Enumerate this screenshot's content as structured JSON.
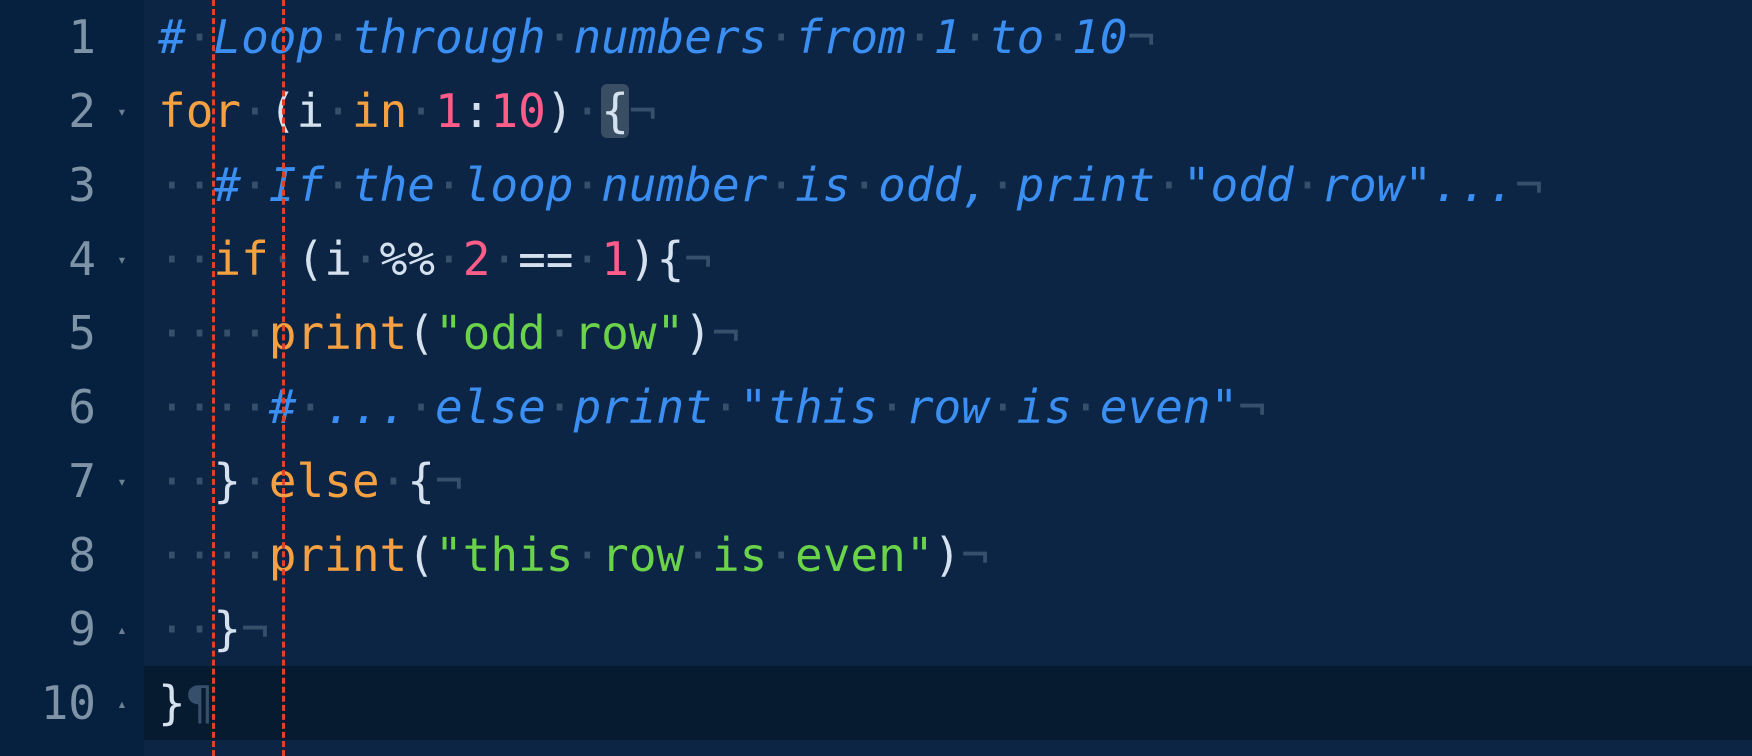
{
  "editor": {
    "lines": [
      {
        "num": "1",
        "fold": "",
        "tokens": [
          {
            "t": "#",
            "c": "c"
          },
          {
            "t": "·",
            "c": "ws"
          },
          {
            "t": "Loop",
            "c": "c"
          },
          {
            "t": "·",
            "c": "ws"
          },
          {
            "t": "through",
            "c": "c"
          },
          {
            "t": "·",
            "c": "ws"
          },
          {
            "t": "numbers",
            "c": "c"
          },
          {
            "t": "·",
            "c": "ws"
          },
          {
            "t": "from",
            "c": "c"
          },
          {
            "t": "·",
            "c": "ws"
          },
          {
            "t": "1",
            "c": "c"
          },
          {
            "t": "·",
            "c": "ws"
          },
          {
            "t": "to",
            "c": "c"
          },
          {
            "t": "·",
            "c": "ws"
          },
          {
            "t": "10",
            "c": "c"
          },
          {
            "t": "¬",
            "c": "eol"
          }
        ]
      },
      {
        "num": "2",
        "fold": "▾",
        "tokens": [
          {
            "t": "for",
            "c": "k"
          },
          {
            "t": "·",
            "c": "ws"
          },
          {
            "t": "(",
            "c": "p"
          },
          {
            "t": "i",
            "c": "p"
          },
          {
            "t": "·",
            "c": "ws"
          },
          {
            "t": "in",
            "c": "k"
          },
          {
            "t": "·",
            "c": "ws"
          },
          {
            "t": "1",
            "c": "n"
          },
          {
            "t": ":",
            "c": "p"
          },
          {
            "t": "10",
            "c": "n"
          },
          {
            "t": ")",
            "c": "p"
          },
          {
            "t": "·",
            "c": "ws"
          },
          {
            "t": "{",
            "c": "p brace-hl"
          },
          {
            "t": "¬",
            "c": "eol"
          }
        ]
      },
      {
        "num": "3",
        "fold": "",
        "tokens": [
          {
            "t": "··",
            "c": "ws"
          },
          {
            "t": "#",
            "c": "c"
          },
          {
            "t": "·",
            "c": "ws"
          },
          {
            "t": "If",
            "c": "c"
          },
          {
            "t": "·",
            "c": "ws"
          },
          {
            "t": "the",
            "c": "c"
          },
          {
            "t": "·",
            "c": "ws"
          },
          {
            "t": "loop",
            "c": "c"
          },
          {
            "t": "·",
            "c": "ws"
          },
          {
            "t": "number",
            "c": "c"
          },
          {
            "t": "·",
            "c": "ws"
          },
          {
            "t": "is",
            "c": "c"
          },
          {
            "t": "·",
            "c": "ws"
          },
          {
            "t": "odd,",
            "c": "c"
          },
          {
            "t": "·",
            "c": "ws"
          },
          {
            "t": "print",
            "c": "c"
          },
          {
            "t": "·",
            "c": "ws"
          },
          {
            "t": "\"odd",
            "c": "c"
          },
          {
            "t": "·",
            "c": "ws"
          },
          {
            "t": "row\"...",
            "c": "c"
          },
          {
            "t": "¬",
            "c": "eol"
          }
        ]
      },
      {
        "num": "4",
        "fold": "▾",
        "tokens": [
          {
            "t": "··",
            "c": "ws"
          },
          {
            "t": "if",
            "c": "k"
          },
          {
            "t": "·",
            "c": "ws"
          },
          {
            "t": "(",
            "c": "p"
          },
          {
            "t": "i",
            "c": "p"
          },
          {
            "t": "·",
            "c": "ws"
          },
          {
            "t": "%%",
            "c": "op"
          },
          {
            "t": "·",
            "c": "ws"
          },
          {
            "t": "2",
            "c": "n"
          },
          {
            "t": "·",
            "c": "ws"
          },
          {
            "t": "==",
            "c": "op"
          },
          {
            "t": "·",
            "c": "ws"
          },
          {
            "t": "1",
            "c": "n"
          },
          {
            "t": "){",
            "c": "p"
          },
          {
            "t": "¬",
            "c": "eol"
          }
        ]
      },
      {
        "num": "5",
        "fold": "",
        "tokens": [
          {
            "t": "····",
            "c": "ws"
          },
          {
            "t": "print",
            "c": "fn"
          },
          {
            "t": "(",
            "c": "p"
          },
          {
            "t": "\"odd",
            "c": "s"
          },
          {
            "t": "·",
            "c": "ws"
          },
          {
            "t": "row\"",
            "c": "s"
          },
          {
            "t": ")",
            "c": "p"
          },
          {
            "t": "¬",
            "c": "eol"
          }
        ]
      },
      {
        "num": "6",
        "fold": "",
        "tokens": [
          {
            "t": "····",
            "c": "ws"
          },
          {
            "t": "#",
            "c": "c"
          },
          {
            "t": "·",
            "c": "ws"
          },
          {
            "t": "...",
            "c": "c"
          },
          {
            "t": "·",
            "c": "ws"
          },
          {
            "t": "else",
            "c": "c"
          },
          {
            "t": "·",
            "c": "ws"
          },
          {
            "t": "print",
            "c": "c"
          },
          {
            "t": "·",
            "c": "ws"
          },
          {
            "t": "\"this",
            "c": "c"
          },
          {
            "t": "·",
            "c": "ws"
          },
          {
            "t": "row",
            "c": "c"
          },
          {
            "t": "·",
            "c": "ws"
          },
          {
            "t": "is",
            "c": "c"
          },
          {
            "t": "·",
            "c": "ws"
          },
          {
            "t": "even\"",
            "c": "c"
          },
          {
            "t": "¬",
            "c": "eol"
          }
        ]
      },
      {
        "num": "7",
        "fold": "▾",
        "tokens": [
          {
            "t": "··",
            "c": "ws"
          },
          {
            "t": "}",
            "c": "p"
          },
          {
            "t": "·",
            "c": "ws"
          },
          {
            "t": "else",
            "c": "k"
          },
          {
            "t": "·",
            "c": "ws"
          },
          {
            "t": "{",
            "c": "p"
          },
          {
            "t": "¬",
            "c": "eol"
          }
        ]
      },
      {
        "num": "8",
        "fold": "",
        "tokens": [
          {
            "t": "····",
            "c": "ws"
          },
          {
            "t": "print",
            "c": "fn"
          },
          {
            "t": "(",
            "c": "p"
          },
          {
            "t": "\"this",
            "c": "s"
          },
          {
            "t": "·",
            "c": "ws"
          },
          {
            "t": "row",
            "c": "s"
          },
          {
            "t": "·",
            "c": "ws"
          },
          {
            "t": "is",
            "c": "s"
          },
          {
            "t": "·",
            "c": "ws"
          },
          {
            "t": "even\"",
            "c": "s"
          },
          {
            "t": ")",
            "c": "p"
          },
          {
            "t": "¬",
            "c": "eol"
          }
        ]
      },
      {
        "num": "9",
        "fold": "▴",
        "tokens": [
          {
            "t": "··",
            "c": "ws"
          },
          {
            "t": "}",
            "c": "p"
          },
          {
            "t": "¬",
            "c": "eol"
          }
        ]
      },
      {
        "num": "10",
        "fold": "▴",
        "active": true,
        "tokens": [
          {
            "t": "}",
            "c": "p"
          },
          {
            "t": "¶",
            "c": "eol"
          }
        ]
      }
    ]
  },
  "colors": {
    "background": "#0c2545",
    "comment": "#3b8ff2",
    "keyword": "#f5a142",
    "number": "#ff5c8a",
    "string": "#6ad34a",
    "indent_guide": "#e0412a"
  }
}
